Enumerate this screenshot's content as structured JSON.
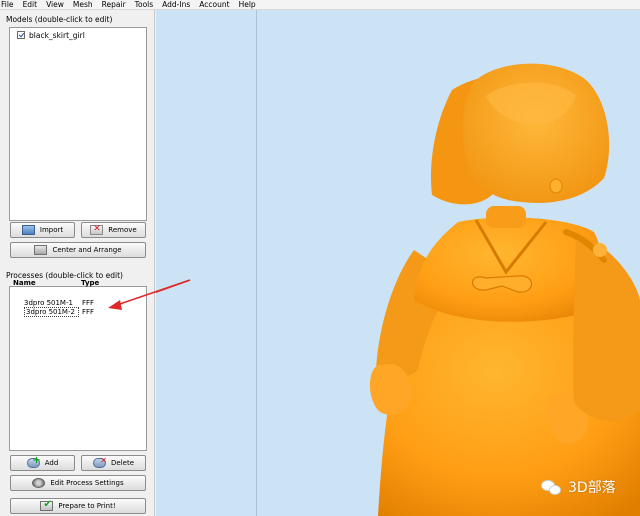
{
  "menu": [
    "File",
    "Edit",
    "View",
    "Mesh",
    "Repair",
    "Tools",
    "Add-Ins",
    "Account",
    "Help"
  ],
  "models": {
    "title": "Models (double-click to edit)",
    "items": [
      {
        "label": "black_skirt_girl",
        "checked": true
      }
    ],
    "import_label": "Import",
    "remove_label": "Remove",
    "center_label": "Center and Arrange"
  },
  "processes": {
    "title": "Processes (double-click to edit)",
    "col_name": "Name",
    "col_type": "Type",
    "rows": [
      {
        "name": "3dpro 501M-1",
        "type": "FFF"
      },
      {
        "name": "3dpro 501M-2",
        "type": "FFF"
      }
    ],
    "add_label": "Add",
    "delete_label": "Delete",
    "edit_label": "Edit Process Settings",
    "print_label": "Prepare to Print!"
  },
  "viewport": {
    "background": "#cce3f5",
    "model_color": "#ffa21a"
  },
  "watermark": {
    "text": "3D部落",
    "icon": "wechat-icon"
  },
  "annotation": {
    "arrow_color": "#e02828"
  }
}
